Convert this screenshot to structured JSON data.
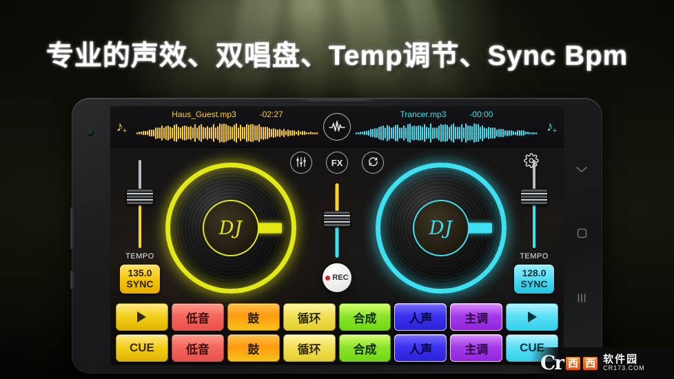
{
  "headline": "专业的声效、双唱盘、Temp调节、Sync Bpm",
  "colors": {
    "deck_a": "#ffd21f",
    "deck_b": "#3ce0f0",
    "accent_rec": "#d2232a",
    "watermark_orange": "#ff8b2a"
  },
  "app": {
    "topbar": {
      "add_track_left_icon": "music-note-plus-icon",
      "add_track_right_icon": "music-note-plus-icon",
      "beat_sync_icon": "waveform-pulse-icon",
      "deck_a": {
        "title": "Haus_Guest.mp3",
        "time": "-02:27"
      },
      "deck_b": {
        "title": "Trancer.mp3",
        "time": "-00:00"
      }
    },
    "center_controls": [
      {
        "name": "eq-icon",
        "label": ""
      },
      {
        "name": "fx-button",
        "label": "FX"
      },
      {
        "name": "loop-sync-icon",
        "label": ""
      }
    ],
    "settings_icon": "gear-icon",
    "decks": {
      "left": {
        "platter_label": "DJ",
        "tempo_label": "TEMPO",
        "bpm": "135.0",
        "sync_label": "SYNC"
      },
      "right": {
        "platter_label": "DJ",
        "tempo_label": "TEMPO",
        "bpm": "128.0",
        "sync_label": "SYNC"
      }
    },
    "record_button": {
      "label": "REC"
    },
    "pads": [
      {
        "name": "deck-a-transport",
        "top": "▶",
        "bottom": "CUE",
        "style": "yellow",
        "top_is_icon": true
      },
      {
        "name": "deck-a-bass",
        "top": "低音",
        "bottom": "低音",
        "style": "red"
      },
      {
        "name": "deck-a-drum",
        "top": "鼓",
        "bottom": "鼓",
        "style": "orange"
      },
      {
        "name": "deck-a-loop",
        "top": "循环",
        "bottom": "循环",
        "style": "paleyellow"
      },
      {
        "name": "deck-b-synth",
        "top": "合成",
        "bottom": "合成",
        "style": "green"
      },
      {
        "name": "deck-b-vocal",
        "top": "人声",
        "bottom": "人声",
        "style": "blue",
        "selected": true
      },
      {
        "name": "deck-b-melody",
        "top": "主调",
        "bottom": "主调",
        "style": "purple",
        "selected": true
      },
      {
        "name": "deck-b-transport",
        "top": "▶",
        "bottom": "CUE",
        "style": "cyan",
        "top_is_icon": true
      }
    ]
  },
  "phone_nav": {
    "back_icon": "chevron-down-icon",
    "home_icon": "home-square-icon",
    "recents_icon": "recents-bars-icon"
  },
  "watermark": {
    "logo": "Cr",
    "box1": "西",
    "box2": "西",
    "name": "软件园",
    "url": "CR173.COM"
  }
}
